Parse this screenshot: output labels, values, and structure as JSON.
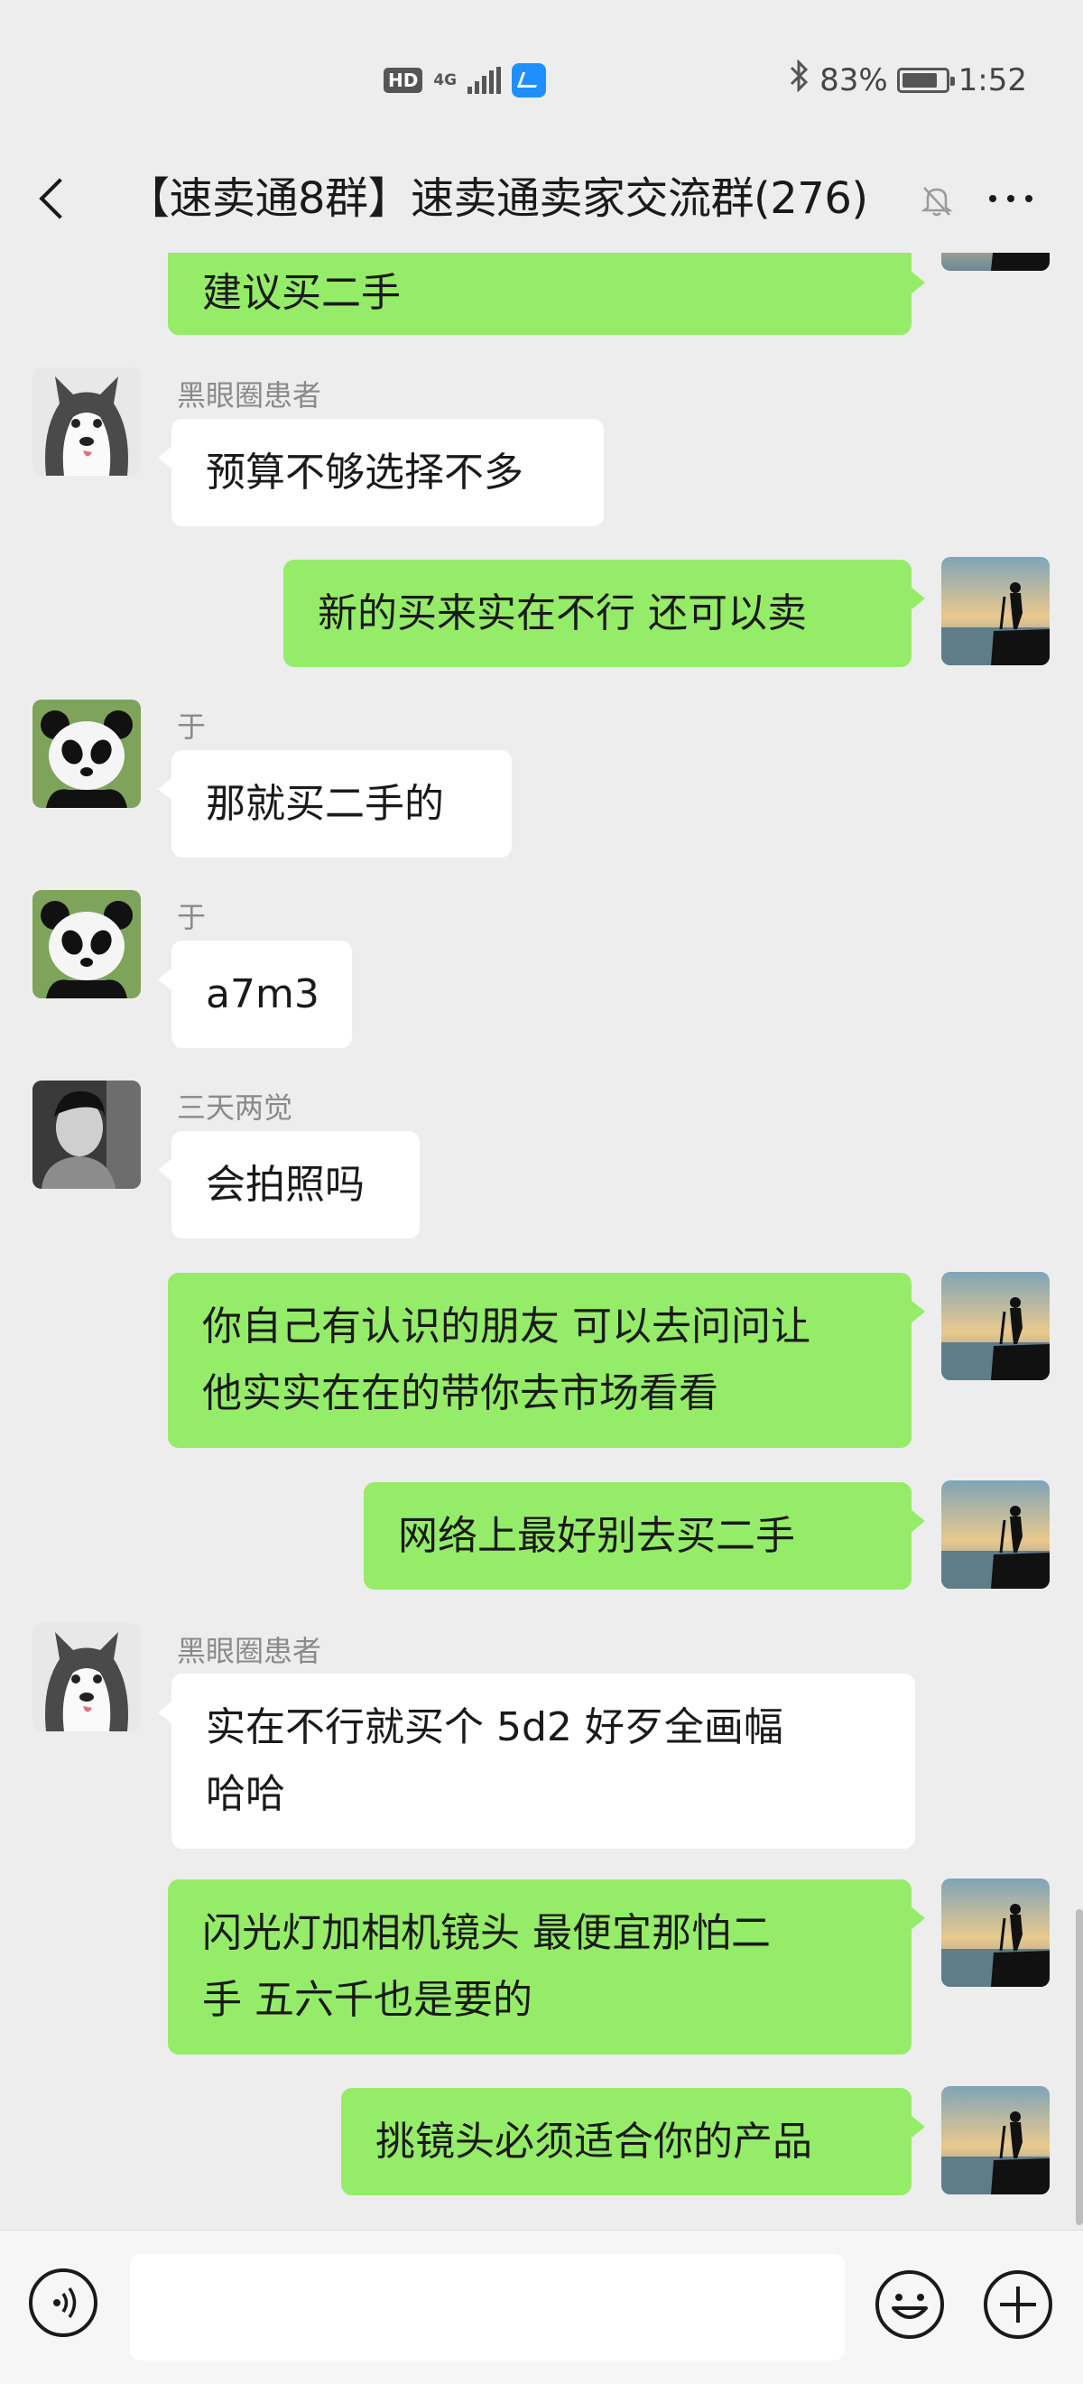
{
  "status_bar": {
    "hd": "HD",
    "network": "4G",
    "battery": "83%",
    "time": "1:52",
    "battery_level": 0.83
  },
  "header": {
    "title": "【速卖通8群】速卖通卖家交流群(276)"
  },
  "messages": [
    {
      "side": "me",
      "text": "建议买二手"
    },
    {
      "side": "other",
      "sender": "黑眼圈患者",
      "avatar": "husky-avatar",
      "text": "预算不够选择不多"
    },
    {
      "side": "me",
      "text": "新的买来实在不行 还可以卖"
    },
    {
      "side": "other",
      "sender": "于",
      "avatar": "panda-avatar",
      "text": "那就买二手的"
    },
    {
      "side": "other",
      "sender": "于",
      "avatar": "panda-avatar",
      "text": "a7m3"
    },
    {
      "side": "other",
      "sender": "三天两觉",
      "avatar": "man-avatar",
      "text": "会拍照吗"
    },
    {
      "side": "me",
      "text": "你自己有认识的朋友 可以去问问让\n他实实在在的带你去市场看看"
    },
    {
      "side": "me",
      "text": "网络上最好别去买二手"
    },
    {
      "side": "other",
      "sender": "黑眼圈患者",
      "avatar": "husky-avatar",
      "text": "实在不行就买个 5d2  好歹全画幅\n哈哈"
    },
    {
      "side": "me",
      "text": "闪光灯加相机镜头 最便宜那怕二\n手 五六千也是要的"
    },
    {
      "side": "me",
      "text": "挑镜头必须适合你的产品"
    }
  ],
  "bottom_bar": {
    "icons": [
      "voice-icon",
      "emoji-icon",
      "plus-icon"
    ]
  },
  "colors": {
    "my_bubble": "#95ec69",
    "other_bubble": "#ffffff",
    "background": "#ededed"
  }
}
